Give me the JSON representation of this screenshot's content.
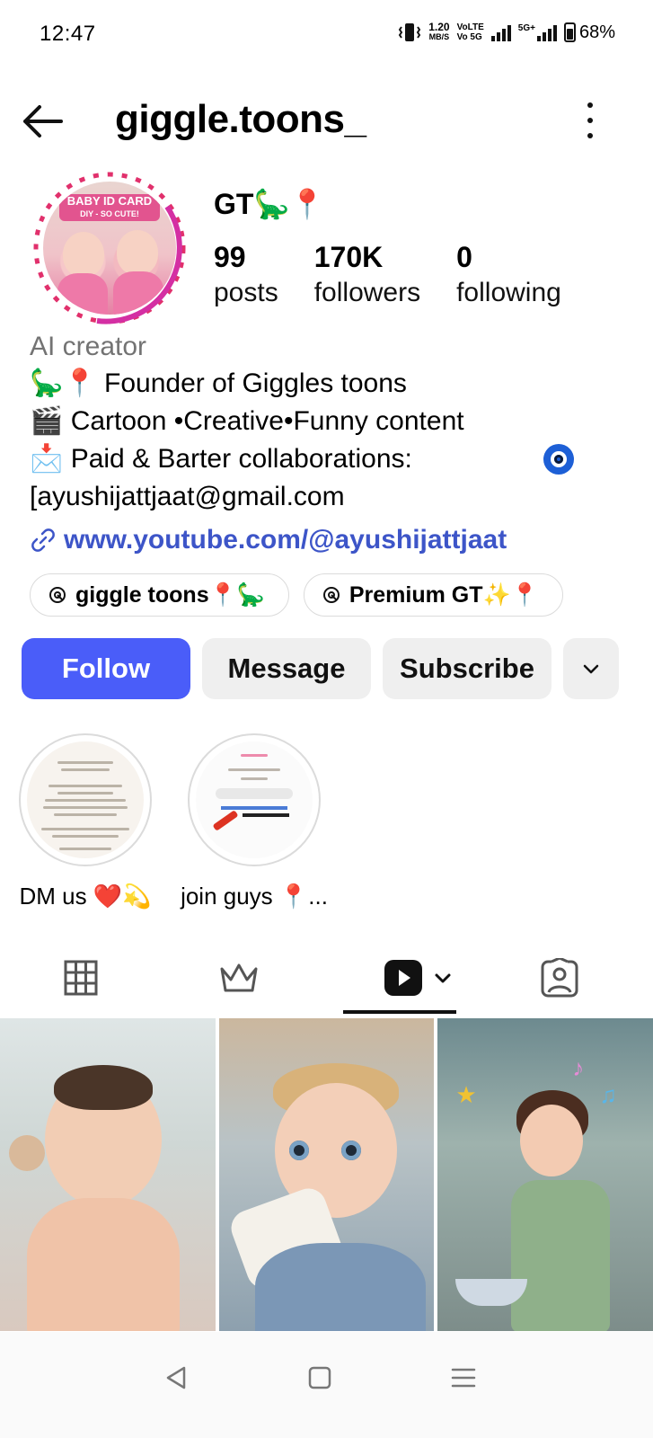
{
  "status_bar": {
    "time": "12:47",
    "net_speed": "1.20",
    "net_unit": "MB/S",
    "volte_1": "VoLTE",
    "volte_2": "Vo 5G",
    "network_5g": "5G+",
    "battery": "68%",
    "battery_level": 0.68
  },
  "header": {
    "username": "giggle.toons_"
  },
  "profile": {
    "avatar_banner": "BABY ID CARD",
    "avatar_banner_sub": "DIY - SO CUTE!",
    "display_name": "GT🦕📍",
    "stats": [
      {
        "value": "99",
        "label": "posts"
      },
      {
        "value": "170K",
        "label": "followers"
      },
      {
        "value": "0",
        "label": "following"
      }
    ],
    "category": "AI creator",
    "bio_lines": [
      "🦕📍 Founder of Giggles toons",
      "🎬 Cartoon •Creative•Funny content",
      "📩 Paid & Barter collaborations:",
      "[ayushijattjaat@gmail.com"
    ],
    "link": "www.youtube.com/@ayushijattjaat"
  },
  "threads": [
    {
      "label": "giggle toons📍🦕"
    },
    {
      "label": "Premium GT✨📍"
    }
  ],
  "actions": {
    "follow": "Follow",
    "message": "Message",
    "subscribe": "Subscribe"
  },
  "highlights": [
    {
      "label": "DM us ❤️💫"
    },
    {
      "label": "join guys 📍..."
    }
  ],
  "tabs": [
    {
      "icon": "grid-icon"
    },
    {
      "icon": "crown-icon"
    },
    {
      "icon": "reels-icon",
      "active": true
    },
    {
      "icon": "tagged-icon"
    }
  ],
  "colors": {
    "follow_button": "#4a5df9",
    "link": "#3d55c8",
    "category": "#737373",
    "story_ring": "#e1306c"
  }
}
